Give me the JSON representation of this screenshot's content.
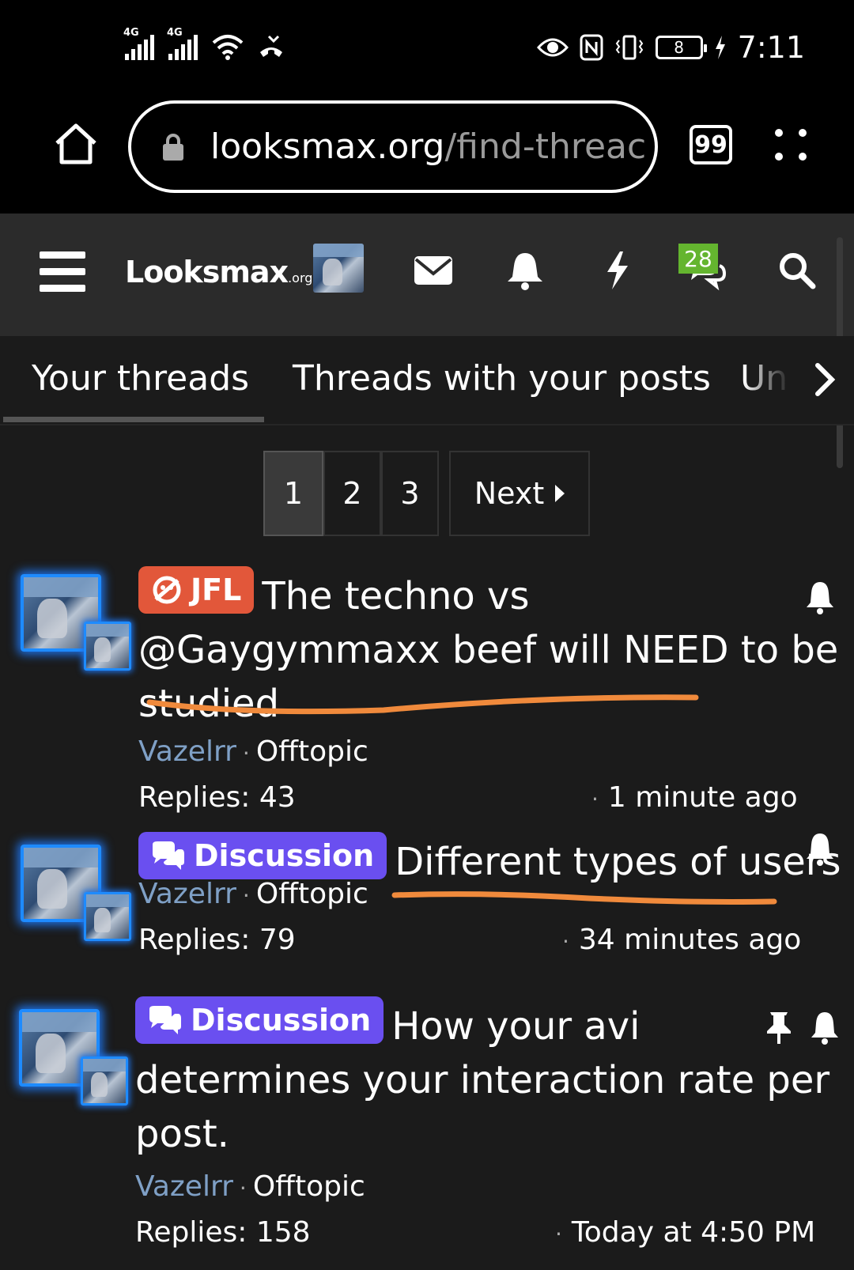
{
  "status_bar": {
    "network_1": "4G",
    "network_2": "4G",
    "time": "7:11",
    "battery": "8"
  },
  "browser": {
    "url_domain": "looksmax.org",
    "url_path": "/find-threac",
    "tab_count": "99"
  },
  "site": {
    "logo_main": "Looksmax",
    "logo_suffix": ".org",
    "conversations_badge": "28"
  },
  "tabs": [
    {
      "label": "Your threads",
      "active": true
    },
    {
      "label": "Threads with your posts",
      "active": false
    },
    {
      "label": "Un",
      "active": false
    }
  ],
  "pagination": {
    "pages": [
      "1",
      "2",
      "3"
    ],
    "current": "1",
    "next_label": "Next"
  },
  "threads": [
    {
      "label": "JFL",
      "title_line1": "The techno vs",
      "title_line2": "@Gaygymmaxx beef will NEED to be",
      "title_line3": "studied",
      "author": "Vazelrr",
      "forum": "Offtopic",
      "replies": "Replies: 43",
      "time": "1 minute ago"
    },
    {
      "label": "Discussion",
      "title_line1": "Different types of users",
      "author": "Vazelrr",
      "forum": "Offtopic",
      "replies": "Replies: 79",
      "time": "34 minutes ago"
    },
    {
      "label": "Discussion",
      "title_line1": "How your avi",
      "title_line2": "determines your interaction rate per",
      "title_line3": "post.",
      "author": "Vazelrr",
      "forum": "Offtopic",
      "replies": "Replies: 158",
      "time": "Today at 4:50 PM",
      "sticky": true
    }
  ],
  "colors": {
    "jfl_label": "#e2573a",
    "discussion_label": "#6a4ff0",
    "author_link": "#7fa0c6",
    "avatar_glow": "#1e8bff",
    "badge_green": "#64b52f",
    "annotation_orange": "#f08a3c"
  },
  "icons": {
    "home": "home-icon",
    "lock": "lock-icon",
    "menu": "hamburger-icon",
    "mail": "envelope-icon",
    "alerts": "bell-icon",
    "whats_new": "lightning-icon",
    "conversations": "chat-icon",
    "search": "search-icon",
    "sticky": "pin-icon",
    "watch": "bell-icon"
  }
}
